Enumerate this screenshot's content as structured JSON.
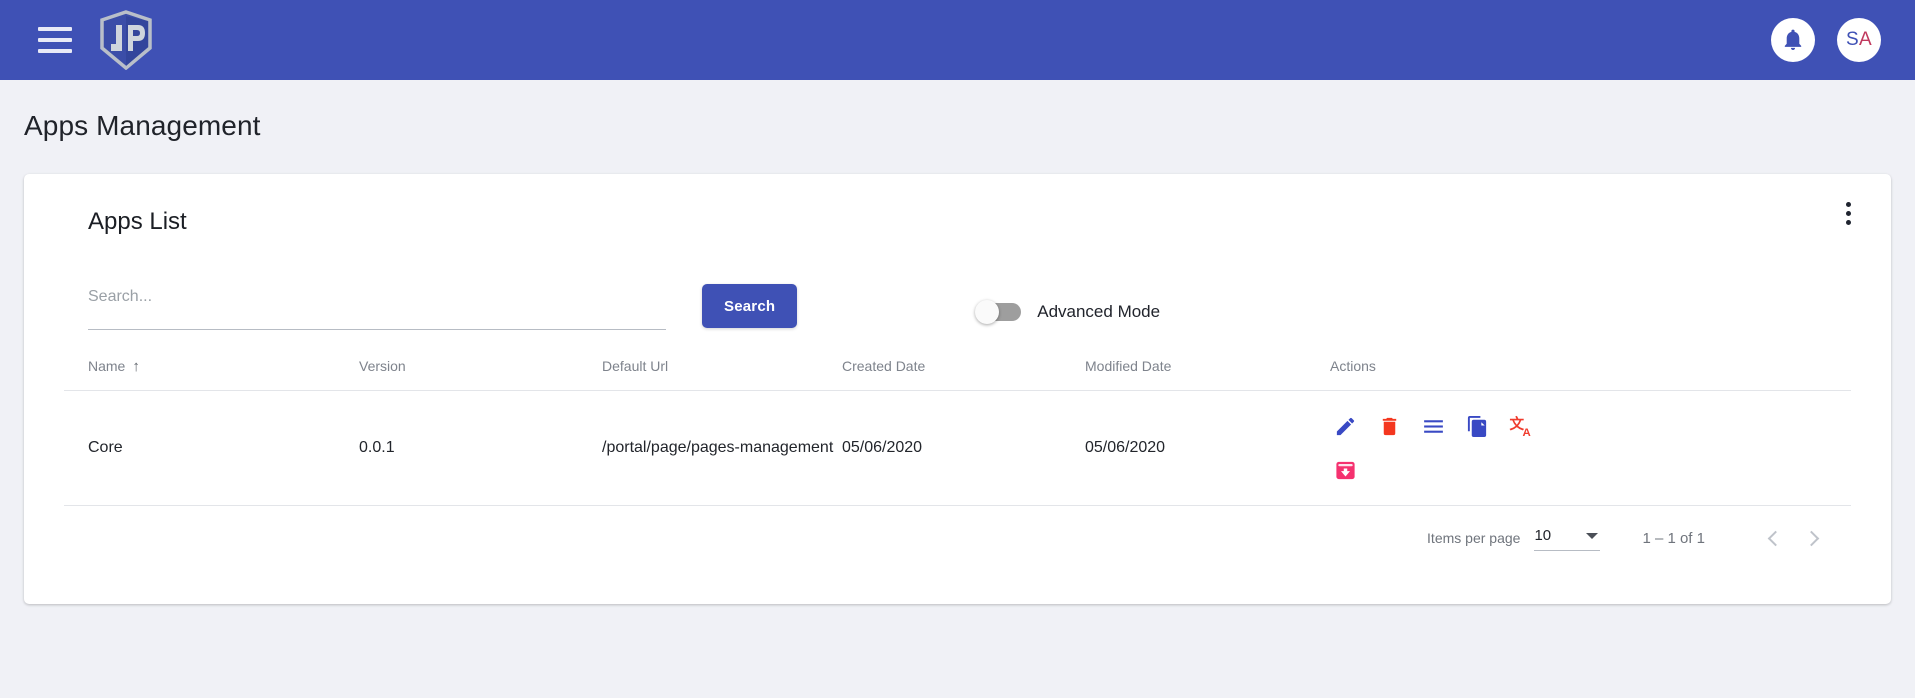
{
  "appbar": {
    "menu_icon": "hamburger-menu-icon",
    "logo_text": "JP",
    "notification_icon": "bell-icon",
    "avatar_initials": "SA",
    "avatar_initial_first": "S",
    "avatar_initial_second": "A",
    "bg_color": "#3f51b5"
  },
  "page": {
    "title": "Apps Management",
    "bg_color": "#f0f1f6"
  },
  "card": {
    "title": "Apps List",
    "menu_icon": "kebab-menu-icon"
  },
  "filters": {
    "search_placeholder": "Search...",
    "search_value": "",
    "search_button_label": "Search",
    "advanced_mode_label": "Advanced Mode",
    "advanced_mode_on": false
  },
  "table": {
    "columns": [
      {
        "label": "Name",
        "sorted": true,
        "sort_direction": "asc",
        "sort_glyph": "↑"
      },
      {
        "label": "Version",
        "sorted": false
      },
      {
        "label": "Default Url",
        "sorted": false
      },
      {
        "label": "Created Date",
        "sorted": false
      },
      {
        "label": "Modified Date",
        "sorted": false
      },
      {
        "label": "Actions",
        "sorted": false
      }
    ],
    "rows": [
      {
        "name": "Core",
        "version": "0.0.1",
        "default_url": "/portal/page/pages-management",
        "created_date": "05/06/2020",
        "modified_date": "05/06/2020",
        "actions": [
          {
            "name": "edit-icon",
            "color": "#3949c4"
          },
          {
            "name": "delete-icon",
            "color": "#f4371f"
          },
          {
            "name": "list-icon",
            "color": "#3949c4"
          },
          {
            "name": "copy-icon",
            "color": "#3949c4"
          },
          {
            "name": "translate-icon",
            "color": "#ef3b2d"
          },
          {
            "name": "archive-download-icon",
            "color": "#f5316f"
          }
        ]
      }
    ]
  },
  "paginator": {
    "items_per_page_label": "Items per page",
    "items_per_page_value": "10",
    "range_label": "1 – 1 of 1",
    "prev_icon": "chevron-left-icon",
    "next_icon": "chevron-right-icon",
    "prev_enabled": false,
    "next_enabled": false
  }
}
